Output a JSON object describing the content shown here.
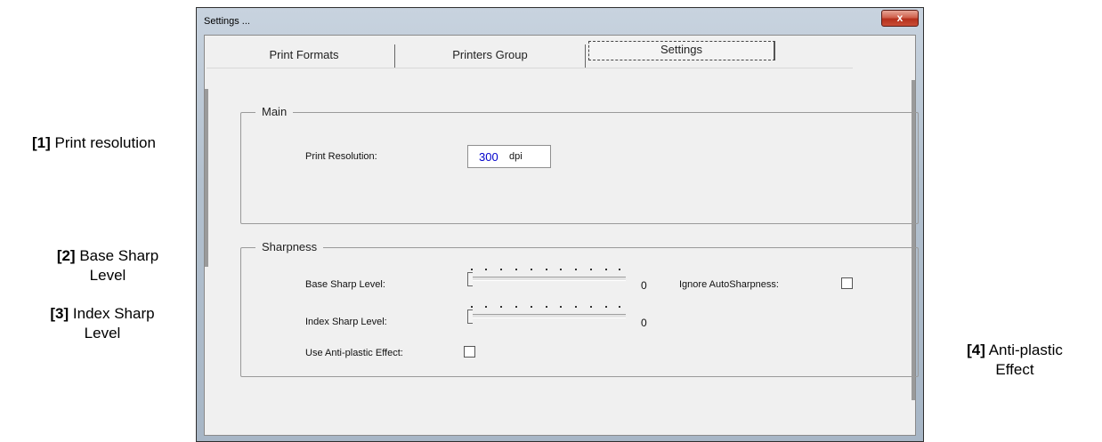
{
  "window": {
    "title": "Settings ...",
    "close_glyph": "x"
  },
  "tabs": [
    {
      "label": "Print Formats",
      "selected": false
    },
    {
      "label": "Printers Group",
      "selected": false
    },
    {
      "label": "Settings",
      "selected": true
    }
  ],
  "main_group": {
    "title": "Main",
    "print_resolution": {
      "label": "Print Resolution:",
      "value": "300",
      "unit": "dpi"
    }
  },
  "sharpness_group": {
    "title": "Sharpness",
    "base_sharp": {
      "label": "Base Sharp Level:",
      "value": "0"
    },
    "index_sharp": {
      "label": "Index Sharp Level:",
      "value": "0"
    },
    "ignore_autosharpness": {
      "label": "Ignore AutoSharpness:",
      "checked": false
    },
    "anti_plastic": {
      "label": "Use Anti-plastic Effect:",
      "checked": false
    }
  },
  "annotations": [
    {
      "num": "[1]",
      "line1": "Print resolution",
      "line2": ""
    },
    {
      "num": "[2]",
      "line1": "Base Sharp",
      "line2": "Level"
    },
    {
      "num": "[3]",
      "line1": "Index Sharp",
      "line2": "Level"
    },
    {
      "num": "[4]",
      "line1": "Anti-plastic",
      "line2": "Effect"
    }
  ],
  "colors": {
    "arrow": "#e5141b",
    "resolution_value": "#0000cc"
  }
}
